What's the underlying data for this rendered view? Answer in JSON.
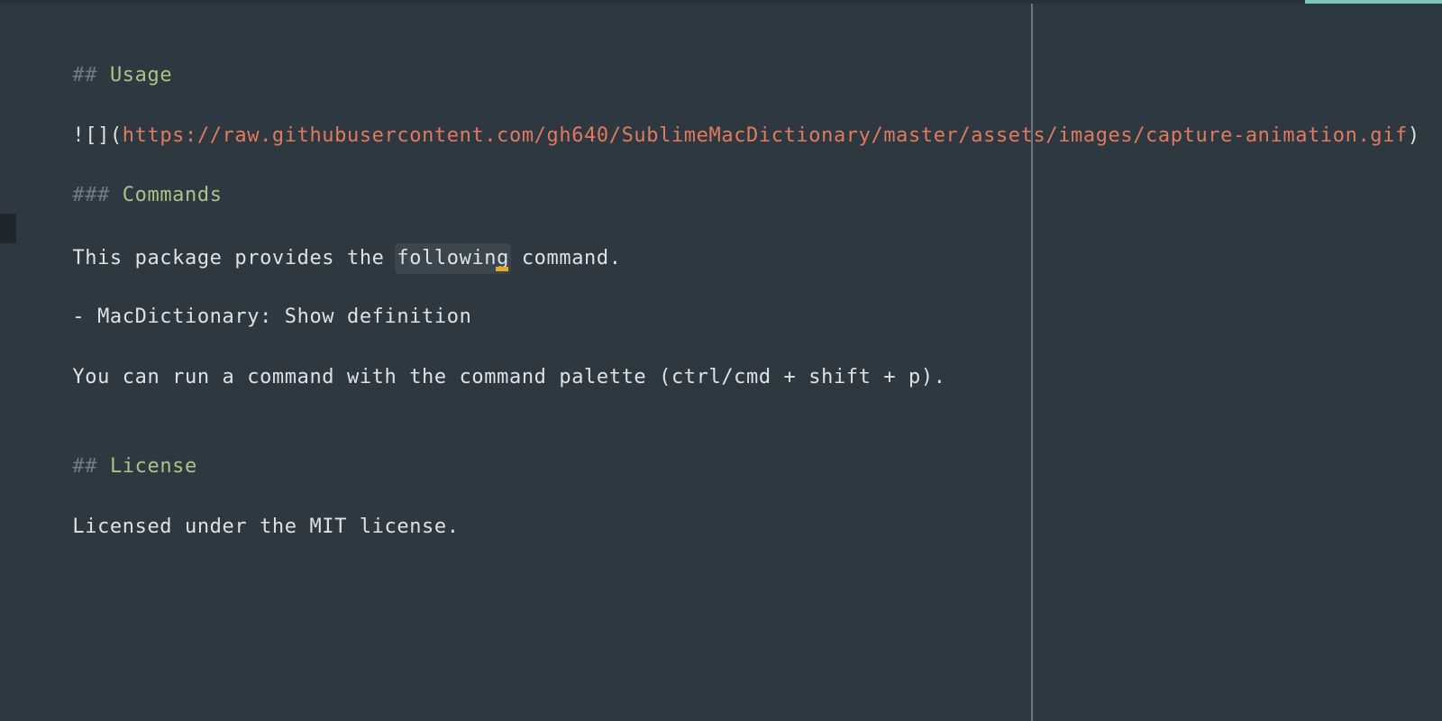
{
  "editor": {
    "lines": [
      {
        "marker": "##",
        "text": "Usage"
      },
      {
        "prefix": "![](",
        "url": "https://raw.githubusercontent.com/gh640/SublimeMacDictionary/master/assets/images/capture-animation.gif",
        "suffix": ")"
      },
      {
        "marker": "###",
        "text": "Commands"
      },
      {
        "before": "This package provides the ",
        "highlight": "following",
        "after": " command."
      },
      {
        "text": "- MacDictionary: Show definition"
      },
      {
        "text": "You can run a command with the command palette (ctrl/cmd + shift + p)."
      },
      {
        "marker": "##",
        "text": "License"
      },
      {
        "text": "Licensed under the MIT license."
      }
    ]
  },
  "colors": {
    "background": "#2e3840",
    "heading": "#a9c487",
    "url": "#e07a5f",
    "marker": "#6f7c84",
    "text": "#dce2e6",
    "cursor": "#e8a923",
    "scroll_indicator": "#7fc4c0"
  }
}
